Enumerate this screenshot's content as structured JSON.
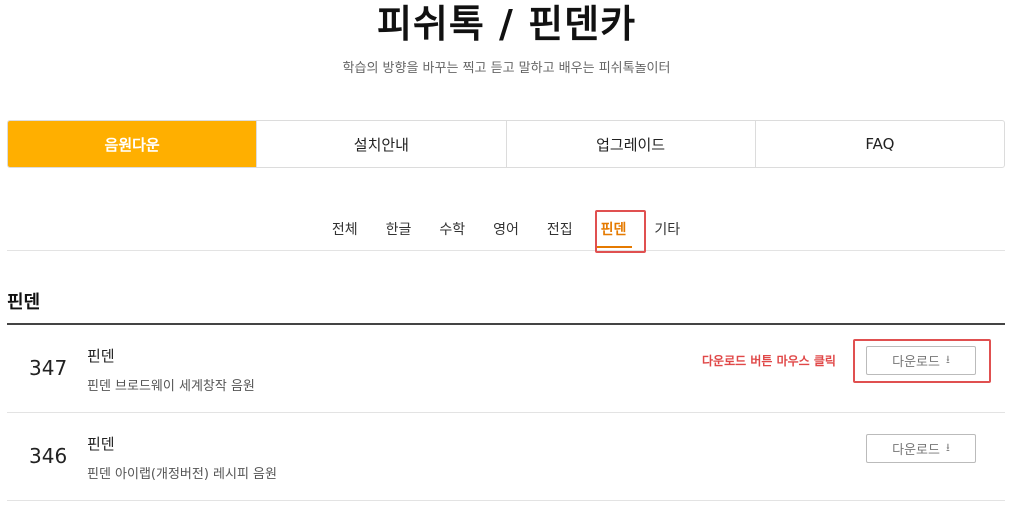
{
  "header": {
    "title": "피쉬톡 / 핀덴카",
    "subtitle": "학습의 방향을 바꾸는 찍고 듣고 말하고 배우는 피쉬톡놀이터"
  },
  "main_tabs": [
    {
      "label": "음원다운",
      "active": true
    },
    {
      "label": "설치안내",
      "active": false
    },
    {
      "label": "업그레이드",
      "active": false
    },
    {
      "label": "FAQ",
      "active": false
    }
  ],
  "sub_tabs": [
    {
      "label": "전체",
      "active": false
    },
    {
      "label": "한글",
      "active": false
    },
    {
      "label": "수학",
      "active": false
    },
    {
      "label": "영어",
      "active": false
    },
    {
      "label": "전집",
      "active": false
    },
    {
      "label": "핀덴",
      "active": true
    },
    {
      "label": "기타",
      "active": false
    }
  ],
  "section": {
    "title": "핀덴"
  },
  "rows": [
    {
      "num": "347",
      "name": "핀덴",
      "desc": "핀덴 브로드웨이 세계창작 음원",
      "button": "다운로드"
    },
    {
      "num": "346",
      "name": "핀덴",
      "desc": "핀덴 아이랩(개정버전) 레시피 음원",
      "button": "다운로드"
    }
  ],
  "annotation": {
    "text": "다운로드 버튼 마우스 클릭"
  },
  "colors": {
    "accent": "#ffaf00",
    "active_sub_tab": "#e57a00",
    "annotation": "#e04848"
  }
}
